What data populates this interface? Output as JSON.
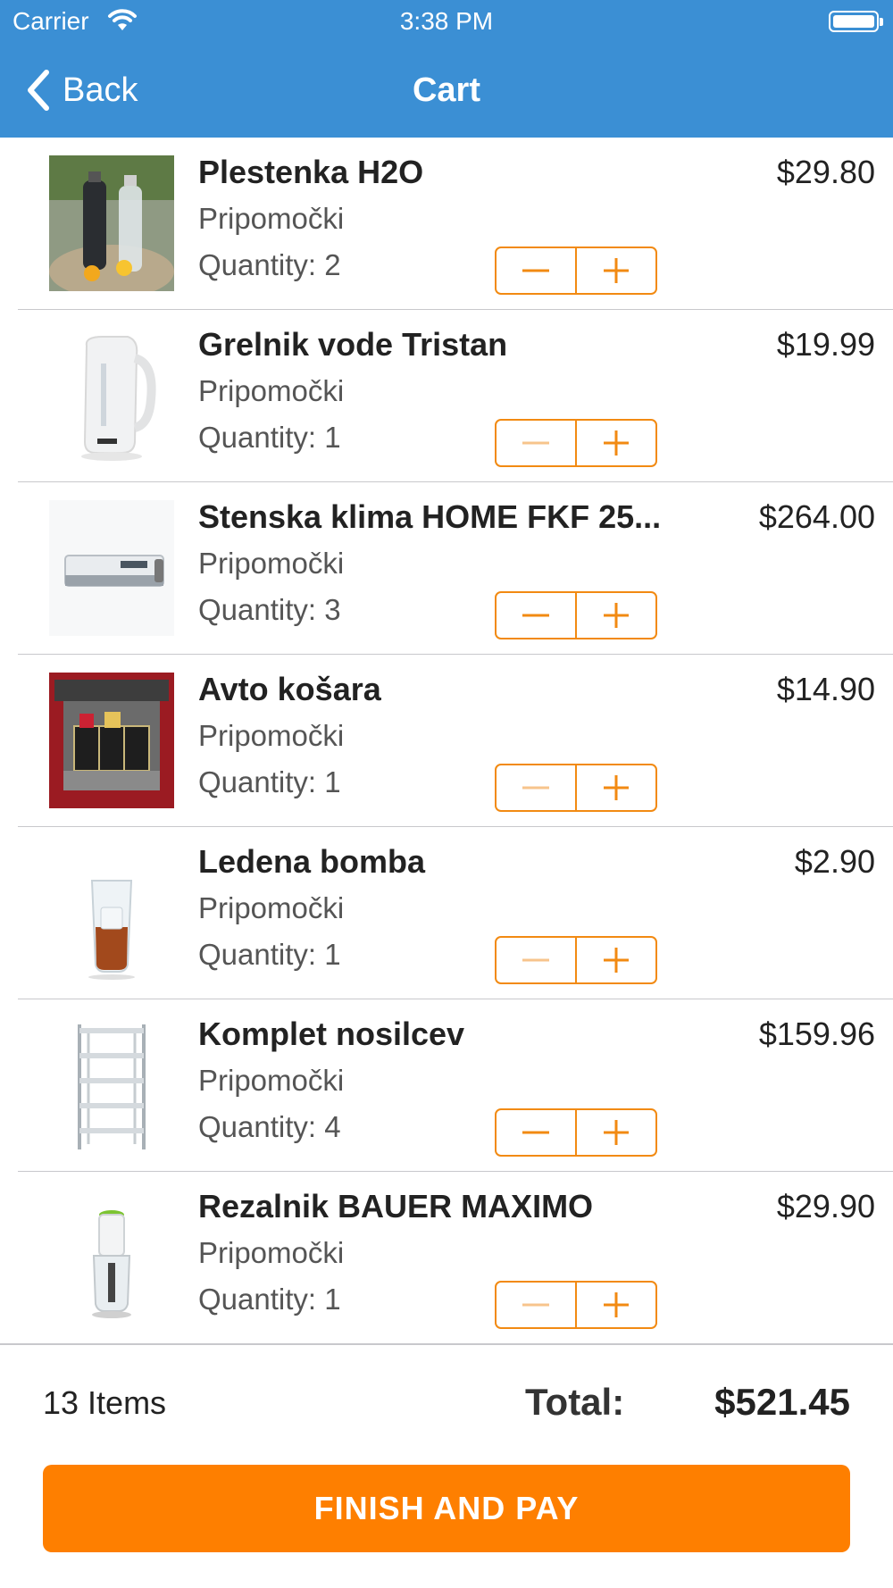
{
  "status_bar": {
    "carrier": "Carrier",
    "time": "3:38 PM"
  },
  "nav": {
    "back_label": "Back",
    "title": "Cart"
  },
  "colors": {
    "header": "#3b8fd4",
    "accent": "#fe7f00",
    "stepper": "#f28a12"
  },
  "items": [
    {
      "name": "Plestenka H2O",
      "category": "Pripomočki",
      "quantity": "Quantity: 2",
      "price": "$29.80",
      "image_icon": "water-bottle-image",
      "minus_enabled": true
    },
    {
      "name": "Grelnik vode Tristan",
      "category": "Pripomočki",
      "quantity": "Quantity: 1",
      "price": "$19.99",
      "image_icon": "kettle-image",
      "minus_enabled": false
    },
    {
      "name": "Stenska klima HOME FKF 25...",
      "category": "Pripomočki",
      "quantity": "Quantity: 3",
      "price": "$264.00",
      "image_icon": "air-conditioner-image",
      "minus_enabled": true
    },
    {
      "name": "Avto košara",
      "category": "Pripomočki",
      "quantity": "Quantity: 1",
      "price": "$14.90",
      "image_icon": "car-trunk-organizer-image",
      "minus_enabled": false
    },
    {
      "name": "Ledena bomba",
      "category": "Pripomočki",
      "quantity": "Quantity: 1",
      "price": "$2.90",
      "image_icon": "ice-glass-image",
      "minus_enabled": false
    },
    {
      "name": "Komplet nosilcev",
      "category": "Pripomočki",
      "quantity": "Quantity: 4",
      "price": "$159.96",
      "image_icon": "shelving-rack-image",
      "minus_enabled": true
    },
    {
      "name": "Rezalnik BAUER MAXIMO",
      "category": "Pripomočki",
      "quantity": "Quantity: 1",
      "price": "$29.90",
      "image_icon": "food-chopper-image",
      "minus_enabled": false
    }
  ],
  "summary": {
    "items_count": "13 Items",
    "total_label": "Total:",
    "total_value": "$521.45"
  },
  "checkout": {
    "label": "FINISH AND PAY"
  }
}
